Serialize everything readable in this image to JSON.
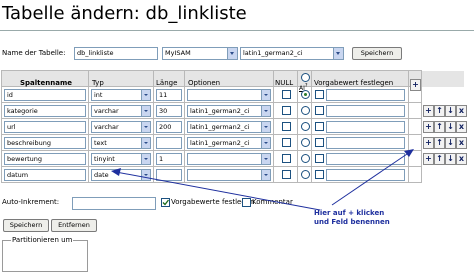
{
  "title": "Tabelle ändern: db_linkliste",
  "table_name": {
    "label": "Name der Tabelle:",
    "value": "db_linkliste",
    "engine": "MyISAM",
    "collation": "latin1_german2_ci",
    "save_label": "Speichern"
  },
  "columns": {
    "name": "Spaltenname",
    "type": "Typ",
    "length": "Länge",
    "options": "Optionen",
    "null": "NULL",
    "ai": "AI",
    "ai_mark": "?",
    "default": "Vorgabewert festlegen",
    "add": "+"
  },
  "rows": [
    {
      "name": "id",
      "type": "int",
      "length": "11",
      "option": "",
      "null": false,
      "ai": true,
      "default_checked": false,
      "default_value": ""
    },
    {
      "name": "kategorie",
      "type": "varchar",
      "length": "30",
      "option": "latin1_german2_ci",
      "null": false,
      "ai": false,
      "default_checked": false,
      "default_value": ""
    },
    {
      "name": "url",
      "type": "varchar",
      "length": "200",
      "option": "latin1_german2_ci",
      "null": false,
      "ai": false,
      "default_checked": false,
      "default_value": ""
    },
    {
      "name": "beschreibung",
      "type": "text",
      "length": "",
      "option": "latin1_german2_ci",
      "null": false,
      "ai": false,
      "default_checked": false,
      "default_value": ""
    },
    {
      "name": "bewertung",
      "type": "tinyint",
      "length": "1",
      "option": "",
      "null": false,
      "ai": false,
      "default_checked": false,
      "default_value": ""
    },
    {
      "name": "datum",
      "type": "date",
      "length": "",
      "option": "",
      "null": false,
      "ai": false,
      "default_checked": false,
      "default_value": ""
    }
  ],
  "row_actions": [
    "+",
    "↑",
    "↓",
    "x"
  ],
  "auto_increment": {
    "label": "Auto-Inkrement:",
    "value": ""
  },
  "defaults_label": "Vorgabewerte festlegen",
  "comment_label": "Kommentar",
  "buttons": {
    "save": "Speichern",
    "remove": "Entfernen"
  },
  "partition_legend": "Partitionieren um",
  "annotation": {
    "line1": "Hier auf + klicken",
    "line2": "und Feld benennen"
  },
  "colors": {
    "annotation": "#1e2f9e",
    "header_bg": "#e5e5e5",
    "border": "#7f9db9"
  }
}
